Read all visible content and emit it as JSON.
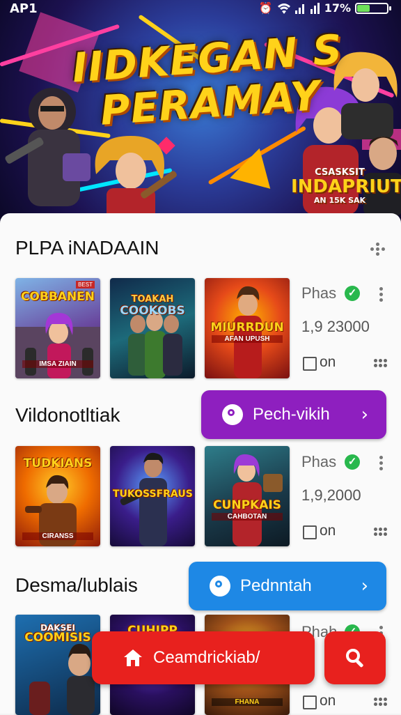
{
  "status_bar": {
    "time": "AP1",
    "battery": "17%",
    "battery_level": 0.17
  },
  "hero": {
    "title_line1": "IIDKEGAN S",
    "title_line2": "PERAMAY",
    "badge_line1": "CSASKSIT",
    "badge_line2": "INDAPRIUTIA",
    "badge_line3": "AN 15K SAK"
  },
  "sections": [
    {
      "title": "PLPA iNADAAIN",
      "cards": [
        {
          "caption": "COBBANEN",
          "sub": "IMSA ZIAIN",
          "tag": "BEST"
        },
        {
          "caption": "COOKOBS",
          "sub": "TOAKAH",
          "tag": ""
        },
        {
          "caption": "MIURRDUN",
          "sub": "AFAN UPUSH",
          "tag": ""
        }
      ],
      "meta": {
        "label": "Phas",
        "count": "1,9 23000",
        "toggle": "on"
      }
    },
    {
      "title": "Vildonotltiak",
      "action": {
        "label": "Pech‐vikih",
        "color": "#8e1fbf"
      },
      "cards": [
        {
          "caption": "TUDKIANS",
          "sub": "CIRANSS",
          "tag": ""
        },
        {
          "caption": "TUKOSSFRAUS",
          "sub": "",
          "tag": ""
        },
        {
          "caption": "CUNPKAIS",
          "sub": "CAHBOTAN",
          "tag": ""
        }
      ],
      "meta": {
        "label": "Phas",
        "count": "1,9,2000",
        "toggle": "on"
      }
    },
    {
      "title": "Desma/lublais",
      "action": {
        "label": "Pednntah",
        "color": "#1e88e5"
      },
      "cards": [
        {
          "caption": "COOMISIS",
          "sub": "DAKSEI",
          "tag": ""
        },
        {
          "caption": "CUHIPP",
          "sub": "",
          "tag": ""
        },
        {
          "caption": "",
          "sub": "FHANA",
          "tag": ""
        }
      ],
      "meta": {
        "label": "Phah",
        "count": "",
        "toggle": "on"
      }
    }
  ],
  "bottom_bar": {
    "home_label": "Ceamdrickiab/",
    "search_icon": "search-icon"
  },
  "colors": {
    "purple_action": "#8e1fbf",
    "blue_action": "#1e88e5",
    "fab_red": "#e8211e",
    "check_green": "#29b84d"
  }
}
